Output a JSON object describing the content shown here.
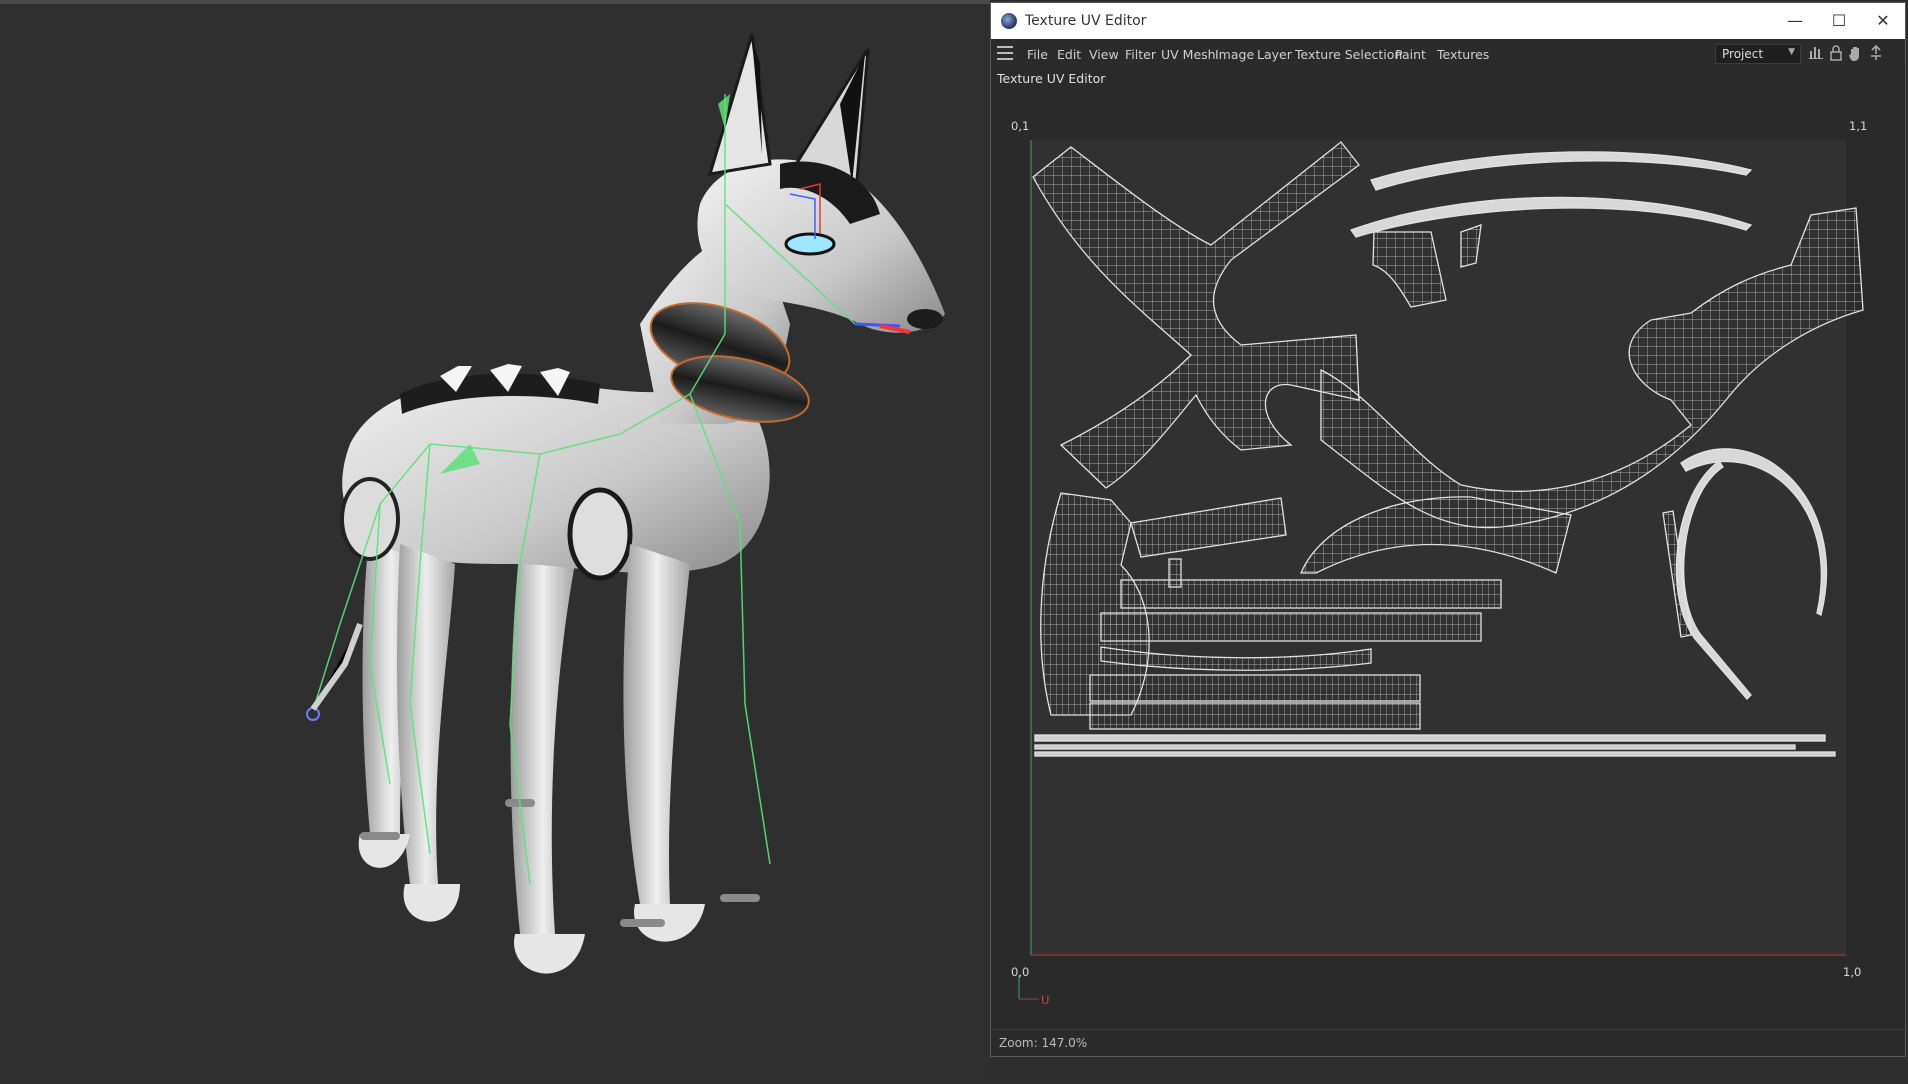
{
  "window": {
    "title": "Texture UV Editor",
    "controls": {
      "minimize": "—",
      "maximize": "☐",
      "close": "✕"
    }
  },
  "menu": {
    "items": [
      "File",
      "Edit",
      "View",
      "Filter",
      "UV Mesh",
      "Image",
      "Layer",
      "Texture Selection",
      "Paint",
      "Textures"
    ],
    "project_select": "Project"
  },
  "editor": {
    "subtitle": "Texture UV Editor",
    "corners": {
      "top_left": "0,1",
      "top_right": "1,1",
      "bottom_left": "0,0",
      "bottom_right": "1,0"
    },
    "axis_label": "U",
    "zoom_text": "Zoom: 147.0%"
  },
  "icons": [
    "menu-icon",
    "histogram-icon",
    "lock-icon",
    "hand-icon",
    "pin-icon"
  ],
  "colors": {
    "viewport_bg": "#2f2f2f",
    "uv_bg": "#2a2a2a",
    "uv_wire": "#d8d8d8",
    "v_axis": "#3fa36a",
    "u_axis": "#b03a3a"
  }
}
